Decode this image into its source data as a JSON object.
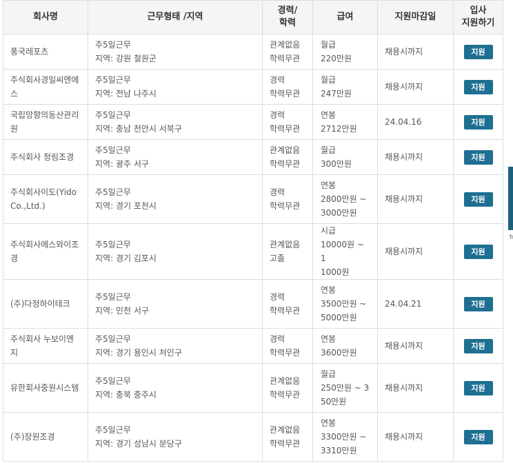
{
  "headers": {
    "company": "회사명",
    "work": "근무형태 /지역",
    "career_line1": "경력/",
    "career_line2": "학력",
    "salary": "급여",
    "deadline": "지원마감일",
    "apply_line1": "입사",
    "apply_line2": "지원하기"
  },
  "apply_label": "지원",
  "rows": [
    {
      "company": "풍국레포츠",
      "work_type": "주5일근무",
      "region": "지역: 강원 철원군",
      "career": "관계없음",
      "education": "학력무관",
      "salary": "월급\n220만원",
      "deadline": "채용시까지"
    },
    {
      "company": "주식회사경일씨앤에스",
      "work_type": "주5일근무",
      "region": "지역: 전남 나주시",
      "career": "경력",
      "education": "학력무관",
      "salary": "월급\n247만원",
      "deadline": "채용시까지"
    },
    {
      "company": "국립망향의동산관리원",
      "work_type": "주5일근무",
      "region": "지역: 충남 천안시 서북구",
      "career": "경력",
      "education": "학력무관",
      "salary": "연봉\n2712만원",
      "deadline": "24.04.16"
    },
    {
      "company": "주식회사 청림조경",
      "work_type": "주5일근무",
      "region": "지역: 광주 서구",
      "career": "관계없음",
      "education": "학력무관",
      "salary": "월급\n300만원",
      "deadline": "채용시까지"
    },
    {
      "company": "주식회사이도(Yido Co.,Ltd.)",
      "work_type": "주5일근무",
      "region": "지역: 경기 포천시",
      "career": "경력",
      "education": "학력무관",
      "salary": "연봉\n2800만원 ~\n3000만원",
      "deadline": "채용시까지"
    },
    {
      "company": "주식회사에스와이조경",
      "work_type": "주5일근무",
      "region": "지역: 경기 김포시",
      "career": "관계없음",
      "education": "고졸",
      "salary": "시급\n10000원 ~ 1\n1000원",
      "deadline": "채용시까지"
    },
    {
      "company": "(주)다정하이테크",
      "work_type": "주5일근무",
      "region": "지역: 인천 서구",
      "career": "경력",
      "education": "학력무관",
      "salary": "연봉\n3500만원 ~\n5000만원",
      "deadline": "24.04.21"
    },
    {
      "company": "주식회사 누보이엔지",
      "work_type": "주5일근무",
      "region": "지역: 경기 용인시 처인구",
      "career": "경력",
      "education": "학력무관",
      "salary": "연봉\n3600만원",
      "deadline": "채용시까지"
    },
    {
      "company": "유한회사중원시스템",
      "work_type": "주5일근무",
      "region": "지역: 충북 충주시",
      "career": "관계없음",
      "education": "학력무관",
      "salary": "월급\n250만원 ~ 3\n50만원",
      "deadline": "채용시까지"
    },
    {
      "company": "(주)장원조경",
      "work_type": "주5일근무",
      "region": "지역: 경기 성남시 분당구",
      "career": "관계없음",
      "education": "학력무관",
      "salary": "연봉\n3300만원 ~\n3310만원",
      "deadline": "채용시까지"
    }
  ],
  "side_widget_text": "Tr",
  "colors": {
    "apply_button": "#1e6f92",
    "header_bg": "#f5f5f5",
    "border": "#dddddd",
    "text": "#555555"
  }
}
